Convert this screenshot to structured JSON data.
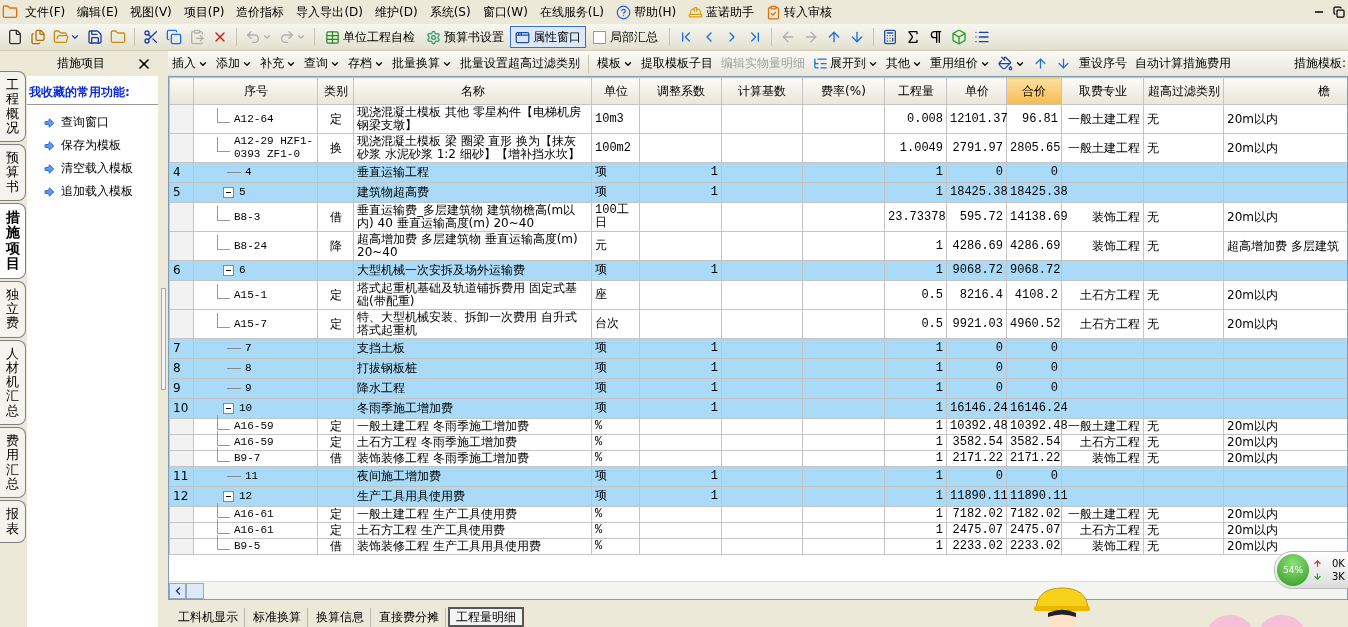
{
  "menu": [
    "文件(F)",
    "编辑(E)",
    "视图(V)",
    "项目(P)",
    "造价指标",
    "导入导出(D)",
    "维护(D)",
    "系统(S)",
    "窗口(W)",
    "在线服务(L)",
    "帮助(H)",
    "蓝诺助手",
    "转入审核"
  ],
  "toolbar": [
    {
      "kind": "icon",
      "disabled": false
    },
    {
      "kind": "icon",
      "disabled": false
    },
    {
      "kind": "icon",
      "disabled": false,
      "dropdown": true
    },
    {
      "kind": "icon",
      "disabled": false
    },
    {
      "kind": "icon",
      "disabled": false
    },
    {
      "kind": "sep"
    },
    {
      "kind": "icon",
      "disabled": false
    },
    {
      "kind": "icon",
      "disabled": false
    },
    {
      "kind": "icon",
      "disabled": true
    },
    {
      "kind": "icon",
      "disabled": false
    },
    {
      "kind": "sep"
    },
    {
      "kind": "icon",
      "disabled": true,
      "dropdown": true
    },
    {
      "kind": "icon",
      "disabled": true,
      "dropdown": true
    },
    {
      "kind": "sep"
    },
    {
      "kind": "text",
      "label": "单位工程自检",
      "pressed": false
    },
    {
      "kind": "text",
      "label": "预算书设置",
      "pressed": false
    },
    {
      "kind": "text",
      "label": "属性窗口",
      "pressed": true
    },
    {
      "kind": "check",
      "label": "局部汇总",
      "checked": false
    },
    {
      "kind": "sep"
    },
    {
      "kind": "icon",
      "disabled": false
    },
    {
      "kind": "icon",
      "disabled": false
    },
    {
      "kind": "icon",
      "disabled": false
    },
    {
      "kind": "icon",
      "disabled": false
    },
    {
      "kind": "sep"
    },
    {
      "kind": "icon",
      "disabled": true
    },
    {
      "kind": "icon",
      "disabled": true
    },
    {
      "kind": "icon",
      "disabled": false
    },
    {
      "kind": "icon",
      "disabled": false
    },
    {
      "kind": "sep"
    },
    {
      "kind": "icon",
      "disabled": false
    },
    {
      "kind": "icon",
      "disabled": false
    },
    {
      "kind": "icon",
      "disabled": false
    },
    {
      "kind": "icon",
      "disabled": false
    },
    {
      "kind": "icon",
      "disabled": false
    }
  ],
  "side_tabs": [
    {
      "label": "工程概况",
      "selected": false
    },
    {
      "label": "预算书",
      "selected": false
    },
    {
      "label": "措施项目",
      "selected": true
    },
    {
      "label": "独立费",
      "selected": false
    },
    {
      "label": "人材机汇总",
      "selected": false
    },
    {
      "label": "费用汇总",
      "selected": false
    },
    {
      "label": "报表",
      "selected": false
    }
  ],
  "panel": {
    "title": "措施项目",
    "heading": "我收藏的常用功能:",
    "items": [
      "查询窗口",
      "保存为模板",
      "清空载入模板",
      "追加载入模板"
    ]
  },
  "toolbar2": [
    {
      "kind": "menu",
      "label": "插入",
      "disabled": false
    },
    {
      "kind": "menu",
      "label": "添加",
      "disabled": false
    },
    {
      "kind": "menu",
      "label": "补充",
      "disabled": false
    },
    {
      "kind": "menu",
      "label": "查询",
      "disabled": false
    },
    {
      "kind": "menu",
      "label": "存档",
      "disabled": false
    },
    {
      "kind": "menu",
      "label": "批量换算",
      "disabled": false
    },
    {
      "kind": "button",
      "label": "批量设置超高过滤类别",
      "disabled": false
    },
    {
      "kind": "menu",
      "label": "模板",
      "disabled": false
    },
    {
      "kind": "button",
      "label": "提取模板子目",
      "disabled": false
    },
    {
      "kind": "button",
      "label": "编辑实物量明细",
      "disabled": true
    },
    {
      "kind": "menu",
      "label": "展开到",
      "disabled": false
    },
    {
      "kind": "menu",
      "label": "其他",
      "disabled": false
    },
    {
      "kind": "menu",
      "label": "重用组价",
      "disabled": false
    },
    {
      "kind": "icon_menu",
      "disabled": false
    },
    {
      "kind": "icon",
      "disabled": false
    },
    {
      "kind": "icon",
      "disabled": false
    },
    {
      "kind": "button",
      "label": "重设序号",
      "disabled": false
    },
    {
      "kind": "button",
      "label": "自动计算措施费用",
      "disabled": false
    }
  ],
  "template_label": "措施模板:",
  "columns": [
    {
      "label": "序号",
      "selected": false
    },
    {
      "label": "类别",
      "selected": false
    },
    {
      "label": "名称",
      "selected": false
    },
    {
      "label": "单位",
      "selected": false
    },
    {
      "label": "调整系数",
      "selected": false
    },
    {
      "label": "计算基数",
      "selected": false
    },
    {
      "label": "费率(%)",
      "selected": false
    },
    {
      "label": "工程量",
      "selected": false
    },
    {
      "label": "单价",
      "selected": false
    },
    {
      "label": "合价",
      "selected": true
    },
    {
      "label": "取费专业",
      "selected": false
    },
    {
      "label": "超高过滤类别",
      "selected": false
    },
    {
      "label": "檐",
      "selected": false
    }
  ],
  "rows": [
    {
      "kind": "item",
      "code": "A12-64",
      "type": "定",
      "name": "现浇混凝土模板 其他 零星构件【电梯机房钢梁支墩】",
      "unit": "10m3",
      "qty": "0.008",
      "price": "12101.37",
      "total": "96.81",
      "fee": "一般土建工程",
      "filter": "无",
      "height": "20m以内"
    },
    {
      "kind": "item",
      "code": "A12-29 HZF1-0393 ZF1-0",
      "type": "换",
      "name": "现浇混凝土模板 梁 圈梁 直形 换为【抹灰砂浆 水泥砂浆 1:2 细砂】【增补挡水坎】",
      "unit": "100m2",
      "qty": "1.0049",
      "price": "2791.97",
      "total": "2805.65",
      "fee": "一般土建工程",
      "filter": "无",
      "height": "20m以内"
    },
    {
      "kind": "group",
      "num": "4",
      "code": "4",
      "name": "垂直运输工程",
      "unit": "项",
      "coef": "1",
      "qty": "1",
      "price": "0",
      "total": "0"
    },
    {
      "kind": "group",
      "num": "5",
      "code": "5",
      "expanded": true,
      "name": "建筑物超高费",
      "unit": "项",
      "coef": "1",
      "qty": "1",
      "price": "18425.38",
      "total": "18425.38",
      "children": [
        {
          "kind": "item",
          "code": "B8-3",
          "type": "借",
          "name": "垂直运输费_多层建筑物 建筑物檐高(m以内) 40 垂直运输高度(m) 20~40",
          "unit": "100工日",
          "qty": "23.73378",
          "price": "595.72",
          "total": "14138.69",
          "fee": "装饰工程",
          "filter": "无",
          "height": "20m以内"
        },
        {
          "kind": "item",
          "code": "B8-24",
          "type": "降",
          "name": "超高增加费 多层建筑物 垂直运输高度(m) 20~40",
          "unit": "元",
          "qty": "1",
          "price": "4286.69",
          "total": "4286.69",
          "fee": "装饰工程",
          "filter": "无",
          "height": "超高增加费 多层建筑"
        }
      ]
    },
    {
      "kind": "group",
      "num": "6",
      "code": "6",
      "expanded": true,
      "name": "大型机械一次安拆及场外运输费",
      "unit": "项",
      "coef": "1",
      "qty": "1",
      "price": "9068.72",
      "total": "9068.72",
      "children": [
        {
          "kind": "item",
          "code": "A15-1",
          "type": "定",
          "name": "塔式起重机基础及轨道铺拆费用 固定式基础(带配重)",
          "unit": "座",
          "qty": "0.5",
          "price": "8216.4",
          "total": "4108.2",
          "fee": "土石方工程",
          "filter": "无",
          "height": "20m以内"
        },
        {
          "kind": "item",
          "code": "A15-7",
          "type": "定",
          "name": "特、大型机械安装、拆卸一次费用 自升式塔式起重机",
          "unit": "台次",
          "qty": "0.5",
          "price": "9921.03",
          "total": "4960.52",
          "fee": "土石方工程",
          "filter": "无",
          "height": "20m以内"
        }
      ]
    },
    {
      "kind": "group",
      "num": "7",
      "code": "7",
      "name": "支挡土板",
      "unit": "项",
      "coef": "1",
      "qty": "1",
      "price": "0",
      "total": "0"
    },
    {
      "kind": "group",
      "num": "8",
      "code": "8",
      "name": "打拔钢板桩",
      "unit": "项",
      "coef": "1",
      "qty": "1",
      "price": "0",
      "total": "0"
    },
    {
      "kind": "group",
      "num": "9",
      "code": "9",
      "name": "降水工程",
      "unit": "项",
      "coef": "1",
      "qty": "1",
      "price": "0",
      "total": "0"
    },
    {
      "kind": "group",
      "num": "10",
      "code": "10",
      "expanded": true,
      "name": "冬雨季施工增加费",
      "unit": "项",
      "coef": "1",
      "qty": "1",
      "price": "16146.24",
      "total": "16146.24",
      "children": [
        {
          "kind": "item",
          "code": "A16-59",
          "type": "定",
          "name": "一般土建工程 冬雨季施工增加费",
          "unit": "%",
          "qty": "1",
          "price": "10392.48",
          "total": "10392.48",
          "fee": "一般土建工程",
          "filter": "无",
          "height": "20m以内"
        },
        {
          "kind": "item",
          "code": "A16-59",
          "type": "定",
          "name": "土石方工程 冬雨季施工增加费",
          "unit": "%",
          "qty": "1",
          "price": "3582.54",
          "total": "3582.54",
          "fee": "土石方工程",
          "filter": "无",
          "height": "20m以内"
        },
        {
          "kind": "item",
          "code": "B9-7",
          "type": "借",
          "name": "装饰装修工程 冬雨季施工增加费",
          "unit": "%",
          "qty": "1",
          "price": "2171.22",
          "total": "2171.22",
          "fee": "装饰工程",
          "filter": "无",
          "height": "20m以内"
        }
      ]
    },
    {
      "kind": "group",
      "num": "11",
      "code": "11",
      "name": "夜间施工增加费",
      "unit": "项",
      "coef": "1",
      "qty": "1",
      "price": "0",
      "total": "0"
    },
    {
      "kind": "group",
      "num": "12",
      "code": "12",
      "expanded": true,
      "name": "生产工具用具使用费",
      "unit": "项",
      "coef": "1",
      "qty": "1",
      "price": "11890.11",
      "total": "11890.11",
      "children": [
        {
          "kind": "item",
          "code": "A16-61",
          "type": "定",
          "name": "一般土建工程  生产工具使用费",
          "unit": "%",
          "qty": "1",
          "price": "7182.02",
          "total": "7182.02",
          "fee": "一般土建工程",
          "filter": "无",
          "height": "20m以内"
        },
        {
          "kind": "item",
          "code": "A16-61",
          "type": "定",
          "name": "土石方工程  生产工具使用费",
          "unit": "%",
          "qty": "1",
          "price": "2475.07",
          "total": "2475.07",
          "fee": "土石方工程",
          "filter": "无",
          "height": "20m以内"
        },
        {
          "kind": "item",
          "code": "B9-5",
          "type": "借",
          "name": "装饰装修工程 生产工具用具使用费",
          "unit": "%",
          "qty": "1",
          "price": "2233.02",
          "total": "2233.02",
          "fee": "装饰工程",
          "filter": "无",
          "height": "20m以内"
        }
      ]
    }
  ],
  "bottom_tabs": [
    {
      "label": "工料机显示",
      "selected": false
    },
    {
      "label": "标准换算",
      "selected": false
    },
    {
      "label": "换算信息",
      "selected": false
    },
    {
      "label": "直接费分摊",
      "selected": false
    },
    {
      "label": "工程量明细",
      "selected": true
    }
  ],
  "network": {
    "usage": "54%",
    "upload": "0K",
    "download": "3K"
  }
}
